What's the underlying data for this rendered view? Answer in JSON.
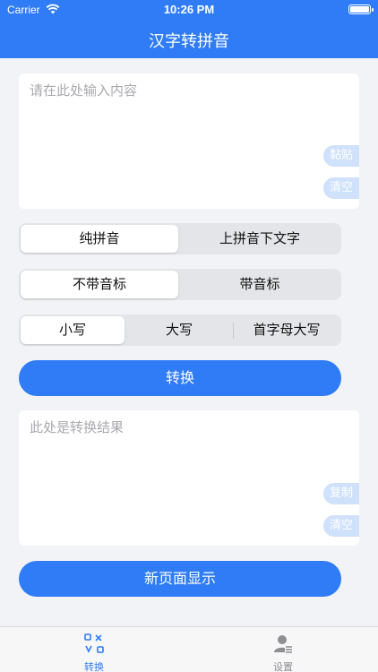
{
  "status_bar": {
    "carrier": "Carrier",
    "time": "10:26 PM"
  },
  "header": {
    "title": "汉字转拼音"
  },
  "input": {
    "placeholder": "请在此处输入内容",
    "paste_label": "黏贴",
    "clear_label": "清空"
  },
  "segments": {
    "pinyin_mode": {
      "options": [
        "纯拼音",
        "上拼音下文字"
      ],
      "selected": 0
    },
    "tone_mode": {
      "options": [
        "不带音标",
        "带音标"
      ],
      "selected": 0
    },
    "case_mode": {
      "options": [
        "小写",
        "大写",
        "首字母大写"
      ],
      "selected": 0
    }
  },
  "convert_button": {
    "label": "转换"
  },
  "result": {
    "placeholder": "此处是转换结果",
    "copy_label": "复制",
    "clear_label": "清空"
  },
  "new_page_button": {
    "label": "新页面显示"
  },
  "tabbar": {
    "items": [
      {
        "label": "转换",
        "icon": "convert-icon",
        "active": true
      },
      {
        "label": "设置",
        "icon": "person-settings-icon",
        "active": false
      }
    ],
    "active_color": "#2f7cf6",
    "inactive_color": "#8e8e93"
  },
  "colors": {
    "accent": "#2f7cf6",
    "background": "#f2f3f6"
  }
}
